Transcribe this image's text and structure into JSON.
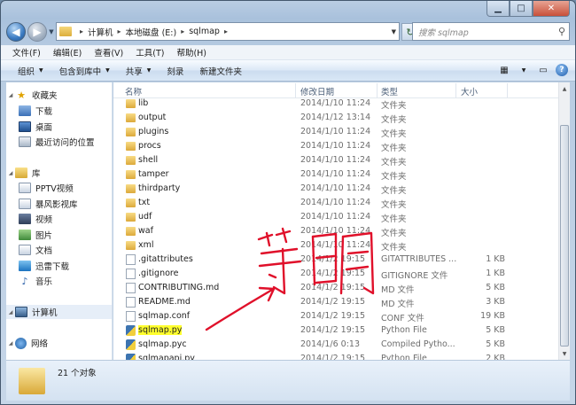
{
  "window": {
    "minimize": "▁",
    "maximize": "□",
    "close": "✕"
  },
  "address": {
    "crumbs": [
      "计算机",
      "本地磁盘 (E:)",
      "sqlmap"
    ]
  },
  "search": {
    "placeholder": "搜索 sqlmap"
  },
  "menu": [
    "文件(F)",
    "编辑(E)",
    "查看(V)",
    "工具(T)",
    "帮助(H)"
  ],
  "toolbar": {
    "organize": "组织",
    "include": "包含到库中",
    "share": "共享",
    "burn": "刻录",
    "new_folder": "新建文件夹"
  },
  "columns": {
    "name": "名称",
    "date": "修改日期",
    "type": "类型",
    "size": "大小"
  },
  "nav": {
    "favorites": "收藏夹",
    "downloads": "下载",
    "desktop": "桌面",
    "recent": "最近访问的位置",
    "libraries": "库",
    "pptv": "PPTV视频",
    "storm": "暴风影视库",
    "videos": "视频",
    "pictures": "图片",
    "documents": "文档",
    "xunlei": "迅雷下载",
    "music": "音乐",
    "computer": "计算机",
    "network": "网络"
  },
  "files": [
    {
      "name": "lib",
      "date": "2014/1/10 11:24",
      "type": "文件夹",
      "size": "",
      "kind": "folder"
    },
    {
      "name": "output",
      "date": "2014/1/12 13:14",
      "type": "文件夹",
      "size": "",
      "kind": "folder"
    },
    {
      "name": "plugins",
      "date": "2014/1/10 11:24",
      "type": "文件夹",
      "size": "",
      "kind": "folder"
    },
    {
      "name": "procs",
      "date": "2014/1/10 11:24",
      "type": "文件夹",
      "size": "",
      "kind": "folder"
    },
    {
      "name": "shell",
      "date": "2014/1/10 11:24",
      "type": "文件夹",
      "size": "",
      "kind": "folder"
    },
    {
      "name": "tamper",
      "date": "2014/1/10 11:24",
      "type": "文件夹",
      "size": "",
      "kind": "folder"
    },
    {
      "name": "thirdparty",
      "date": "2014/1/10 11:24",
      "type": "文件夹",
      "size": "",
      "kind": "folder"
    },
    {
      "name": "txt",
      "date": "2014/1/10 11:24",
      "type": "文件夹",
      "size": "",
      "kind": "folder"
    },
    {
      "name": "udf",
      "date": "2014/1/10 11:24",
      "type": "文件夹",
      "size": "",
      "kind": "folder"
    },
    {
      "name": "waf",
      "date": "2014/1/10 11:24",
      "type": "文件夹",
      "size": "",
      "kind": "folder"
    },
    {
      "name": "xml",
      "date": "2014/1/10 11:24",
      "type": "文件夹",
      "size": "",
      "kind": "folder"
    },
    {
      "name": ".gitattributes",
      "date": "2014/1/2 19:15",
      "type": "GITATTRIBUTES ...",
      "size": "1 KB",
      "kind": "file"
    },
    {
      "name": ".gitignore",
      "date": "2014/1/2 19:15",
      "type": "GITIGNORE 文件",
      "size": "1 KB",
      "kind": "file"
    },
    {
      "name": "CONTRIBUTING.md",
      "date": "2014/1/2 19:15",
      "type": "MD 文件",
      "size": "5 KB",
      "kind": "file"
    },
    {
      "name": "README.md",
      "date": "2014/1/2 19:15",
      "type": "MD 文件",
      "size": "3 KB",
      "kind": "file"
    },
    {
      "name": "sqlmap.conf",
      "date": "2014/1/2 19:15",
      "type": "CONF 文件",
      "size": "19 KB",
      "kind": "file"
    },
    {
      "name": "sqlmap.py",
      "date": "2014/1/2 19:15",
      "type": "Python File",
      "size": "5 KB",
      "kind": "py",
      "highlight": true
    },
    {
      "name": "sqlmap.pyc",
      "date": "2014/1/6 0:13",
      "type": "Compiled Pytho...",
      "size": "5 KB",
      "kind": "py"
    },
    {
      "name": "sqlmapapi.py",
      "date": "2014/1/2 19:15",
      "type": "Python File",
      "size": "2 KB",
      "kind": "py"
    }
  ],
  "status": {
    "count": "21 个对象"
  },
  "annotation": {
    "text": "箬明",
    "color": "#e0102a"
  }
}
